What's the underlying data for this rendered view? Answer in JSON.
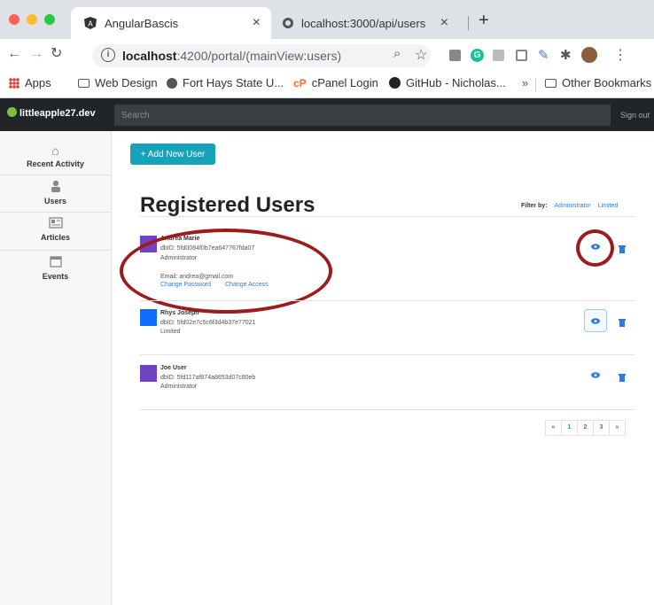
{
  "browser": {
    "tabs": [
      {
        "title": "AngularBascis",
        "active": true
      },
      {
        "title": "localhost:3000/api/users",
        "active": false
      }
    ],
    "url_host": "localhost",
    "url_rest": ":4200/portal/(mainView:users)",
    "bookmarks": [
      "Apps",
      "Web Design",
      "Fort Hays State U...",
      "cPanel Login",
      "GitHub - Nicholas...",
      "Other Bookmarks"
    ],
    "overflow": "»"
  },
  "app": {
    "brand": "littleapple27.dev",
    "search_placeholder": "Search",
    "signout": "Sign out",
    "sidebar": [
      {
        "label": "Recent Activity",
        "icon": "home-icon"
      },
      {
        "label": "Users",
        "icon": "user-icon"
      },
      {
        "label": "Articles",
        "icon": "newspaper-icon"
      },
      {
        "label": "Events",
        "icon": "calendar-icon"
      }
    ],
    "add_button": "+ Add New User",
    "title": "Registered Users",
    "filter_label": "Filter by:",
    "filter_options": [
      "Administrator",
      "Limited"
    ],
    "users": [
      {
        "name": "Andrea Marie",
        "dbid": "dbID: 5fd0084f0b7ea647767fda07",
        "role": "Administrator",
        "email": "Email: andrea@gmail.com",
        "change_password": "Change Password",
        "change_access": "Change Access",
        "avatar_color": "#6f42c1"
      },
      {
        "name": "Rhys Joseph",
        "dbid": "dbID: 5fd02e7c5c6f3d4b37e77021",
        "role": "Limited",
        "avatar_color": "#0d6efd"
      },
      {
        "name": "Joe User",
        "dbid": "dbID: 5fd117af874a8653d07c80eb",
        "role": "Administrator",
        "avatar_color": "#6f42c1"
      }
    ],
    "pagination": [
      "«",
      "1",
      "2",
      "3",
      "»"
    ]
  },
  "colors": {
    "accent": "#17a2b8",
    "link": "#2c7be5",
    "annotation": "#9b1c1c"
  }
}
